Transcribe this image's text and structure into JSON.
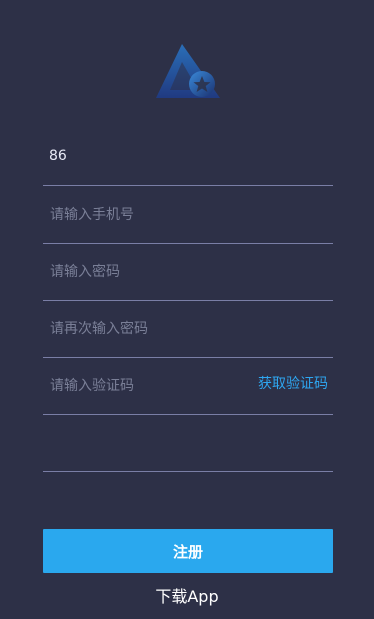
{
  "app": {
    "logo_icon": "triangle-star-logo"
  },
  "form": {
    "country_code": "86",
    "phone": {
      "value": "",
      "placeholder": "请输入手机号"
    },
    "password": {
      "value": "",
      "placeholder": "请输入密码"
    },
    "confirm_password": {
      "value": "",
      "placeholder": "请再次输入密码"
    },
    "verification_code": {
      "value": "",
      "placeholder": "请输入验证码"
    },
    "get_code_label": "获取验证码",
    "extra_field": {
      "value": "",
      "placeholder": ""
    }
  },
  "actions": {
    "register_label": "注册",
    "download_label": "下载App"
  },
  "colors": {
    "background": "#2d3047",
    "accent": "#2aa8ee",
    "link": "#2ea6f0",
    "divider": "#7a7ea6"
  }
}
